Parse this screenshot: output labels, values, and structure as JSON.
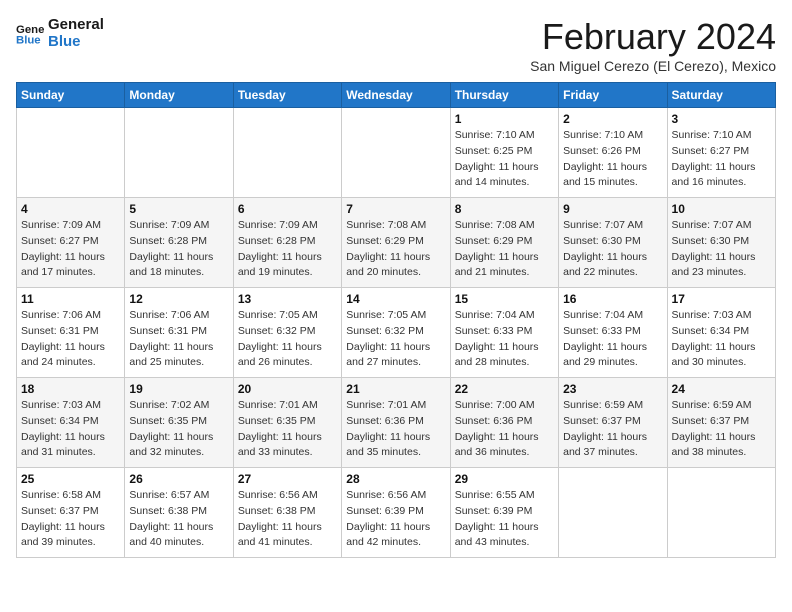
{
  "header": {
    "logo_line1": "General",
    "logo_line2": "Blue",
    "month": "February 2024",
    "location": "San Miguel Cerezo (El Cerezo), Mexico"
  },
  "days_of_week": [
    "Sunday",
    "Monday",
    "Tuesday",
    "Wednesday",
    "Thursday",
    "Friday",
    "Saturday"
  ],
  "weeks": [
    [
      {
        "day": "",
        "info": ""
      },
      {
        "day": "",
        "info": ""
      },
      {
        "day": "",
        "info": ""
      },
      {
        "day": "",
        "info": ""
      },
      {
        "day": "1",
        "sunrise": "7:10 AM",
        "sunset": "6:25 PM",
        "daylight": "11 hours and 14 minutes."
      },
      {
        "day": "2",
        "sunrise": "7:10 AM",
        "sunset": "6:26 PM",
        "daylight": "11 hours and 15 minutes."
      },
      {
        "day": "3",
        "sunrise": "7:10 AM",
        "sunset": "6:27 PM",
        "daylight": "11 hours and 16 minutes."
      }
    ],
    [
      {
        "day": "4",
        "sunrise": "7:09 AM",
        "sunset": "6:27 PM",
        "daylight": "11 hours and 17 minutes."
      },
      {
        "day": "5",
        "sunrise": "7:09 AM",
        "sunset": "6:28 PM",
        "daylight": "11 hours and 18 minutes."
      },
      {
        "day": "6",
        "sunrise": "7:09 AM",
        "sunset": "6:28 PM",
        "daylight": "11 hours and 19 minutes."
      },
      {
        "day": "7",
        "sunrise": "7:08 AM",
        "sunset": "6:29 PM",
        "daylight": "11 hours and 20 minutes."
      },
      {
        "day": "8",
        "sunrise": "7:08 AM",
        "sunset": "6:29 PM",
        "daylight": "11 hours and 21 minutes."
      },
      {
        "day": "9",
        "sunrise": "7:07 AM",
        "sunset": "6:30 PM",
        "daylight": "11 hours and 22 minutes."
      },
      {
        "day": "10",
        "sunrise": "7:07 AM",
        "sunset": "6:30 PM",
        "daylight": "11 hours and 23 minutes."
      }
    ],
    [
      {
        "day": "11",
        "sunrise": "7:06 AM",
        "sunset": "6:31 PM",
        "daylight": "11 hours and 24 minutes."
      },
      {
        "day": "12",
        "sunrise": "7:06 AM",
        "sunset": "6:31 PM",
        "daylight": "11 hours and 25 minutes."
      },
      {
        "day": "13",
        "sunrise": "7:05 AM",
        "sunset": "6:32 PM",
        "daylight": "11 hours and 26 minutes."
      },
      {
        "day": "14",
        "sunrise": "7:05 AM",
        "sunset": "6:32 PM",
        "daylight": "11 hours and 27 minutes."
      },
      {
        "day": "15",
        "sunrise": "7:04 AM",
        "sunset": "6:33 PM",
        "daylight": "11 hours and 28 minutes."
      },
      {
        "day": "16",
        "sunrise": "7:04 AM",
        "sunset": "6:33 PM",
        "daylight": "11 hours and 29 minutes."
      },
      {
        "day": "17",
        "sunrise": "7:03 AM",
        "sunset": "6:34 PM",
        "daylight": "11 hours and 30 minutes."
      }
    ],
    [
      {
        "day": "18",
        "sunrise": "7:03 AM",
        "sunset": "6:34 PM",
        "daylight": "11 hours and 31 minutes."
      },
      {
        "day": "19",
        "sunrise": "7:02 AM",
        "sunset": "6:35 PM",
        "daylight": "11 hours and 32 minutes."
      },
      {
        "day": "20",
        "sunrise": "7:01 AM",
        "sunset": "6:35 PM",
        "daylight": "11 hours and 33 minutes."
      },
      {
        "day": "21",
        "sunrise": "7:01 AM",
        "sunset": "6:36 PM",
        "daylight": "11 hours and 35 minutes."
      },
      {
        "day": "22",
        "sunrise": "7:00 AM",
        "sunset": "6:36 PM",
        "daylight": "11 hours and 36 minutes."
      },
      {
        "day": "23",
        "sunrise": "6:59 AM",
        "sunset": "6:37 PM",
        "daylight": "11 hours and 37 minutes."
      },
      {
        "day": "24",
        "sunrise": "6:59 AM",
        "sunset": "6:37 PM",
        "daylight": "11 hours and 38 minutes."
      }
    ],
    [
      {
        "day": "25",
        "sunrise": "6:58 AM",
        "sunset": "6:37 PM",
        "daylight": "11 hours and 39 minutes."
      },
      {
        "day": "26",
        "sunrise": "6:57 AM",
        "sunset": "6:38 PM",
        "daylight": "11 hours and 40 minutes."
      },
      {
        "day": "27",
        "sunrise": "6:56 AM",
        "sunset": "6:38 PM",
        "daylight": "11 hours and 41 minutes."
      },
      {
        "day": "28",
        "sunrise": "6:56 AM",
        "sunset": "6:39 PM",
        "daylight": "11 hours and 42 minutes."
      },
      {
        "day": "29",
        "sunrise": "6:55 AM",
        "sunset": "6:39 PM",
        "daylight": "11 hours and 43 minutes."
      },
      {
        "day": "",
        "info": ""
      },
      {
        "day": "",
        "info": ""
      }
    ]
  ],
  "labels": {
    "sunrise_prefix": "Sunrise: ",
    "sunset_prefix": "Sunset: ",
    "daylight_label": "Daylight: "
  }
}
